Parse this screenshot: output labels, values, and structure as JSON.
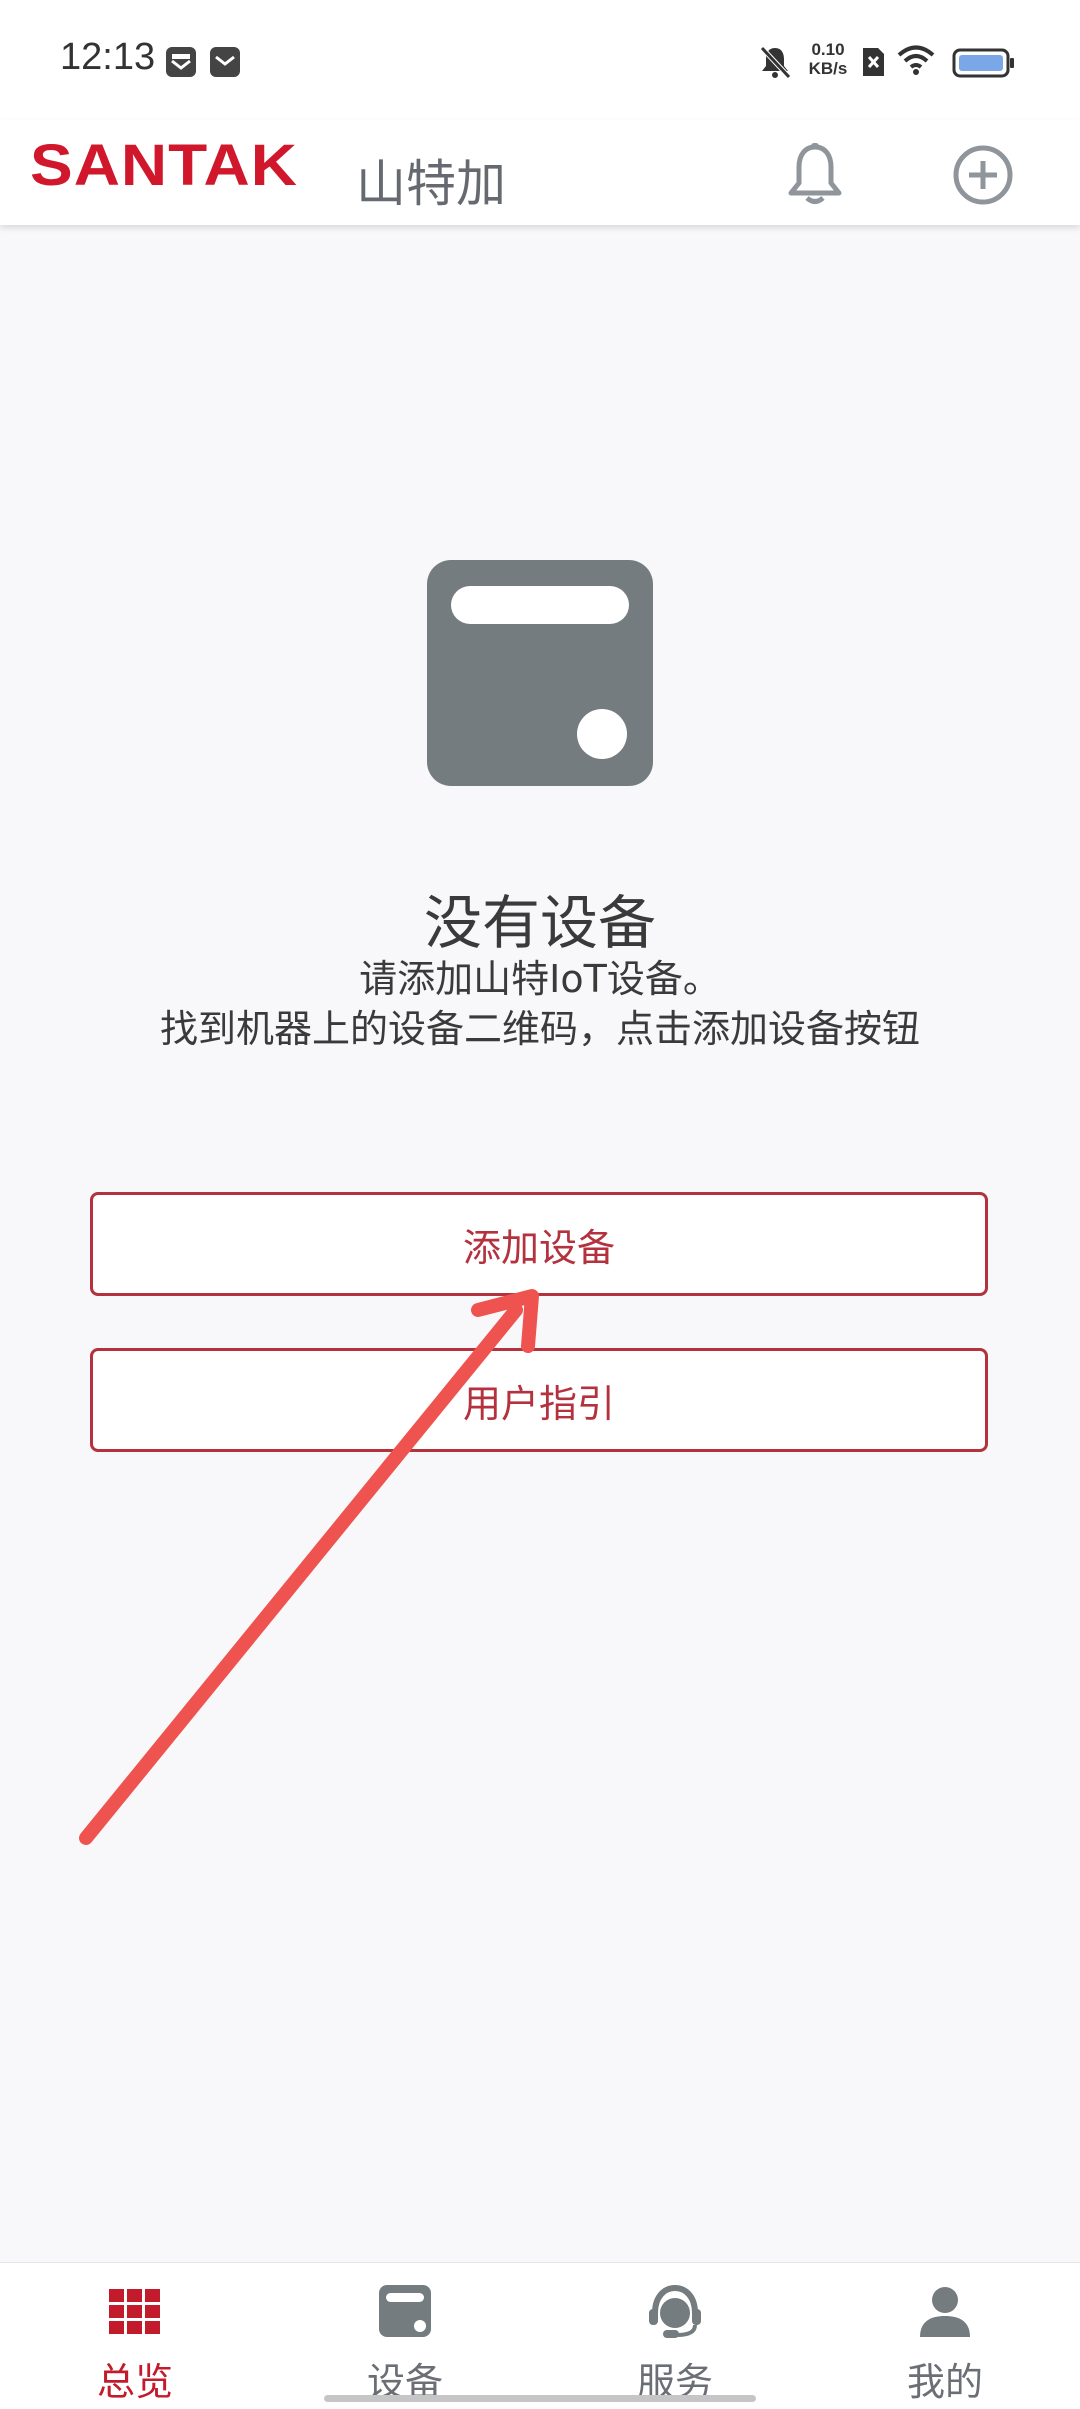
{
  "status_bar": {
    "time": "12:13",
    "netspeed_value": "0.10",
    "netspeed_unit": "KB/s"
  },
  "header": {
    "brand_logo": "SANTAK",
    "brand_name": "山特加"
  },
  "empty_state": {
    "title": "没有设备",
    "description_line1": "请添加山特IoT设备。",
    "description_line2": "找到机器上的设备二维码，点击添加设备按钮"
  },
  "actions": {
    "add_device": "添加设备",
    "user_guide": "用户指引"
  },
  "nav": {
    "items": [
      {
        "label": "总览",
        "icon": "grid-icon",
        "active": true
      },
      {
        "label": "设备",
        "icon": "device-icon",
        "active": false
      },
      {
        "label": "服务",
        "icon": "headset-icon",
        "active": false
      },
      {
        "label": "我的",
        "icon": "person-icon",
        "active": false
      }
    ]
  },
  "colors": {
    "brand_red": "#d0172b",
    "button_red": "#b3323e",
    "icon_gray": "#747c80",
    "annotation_red": "#ef5350"
  }
}
